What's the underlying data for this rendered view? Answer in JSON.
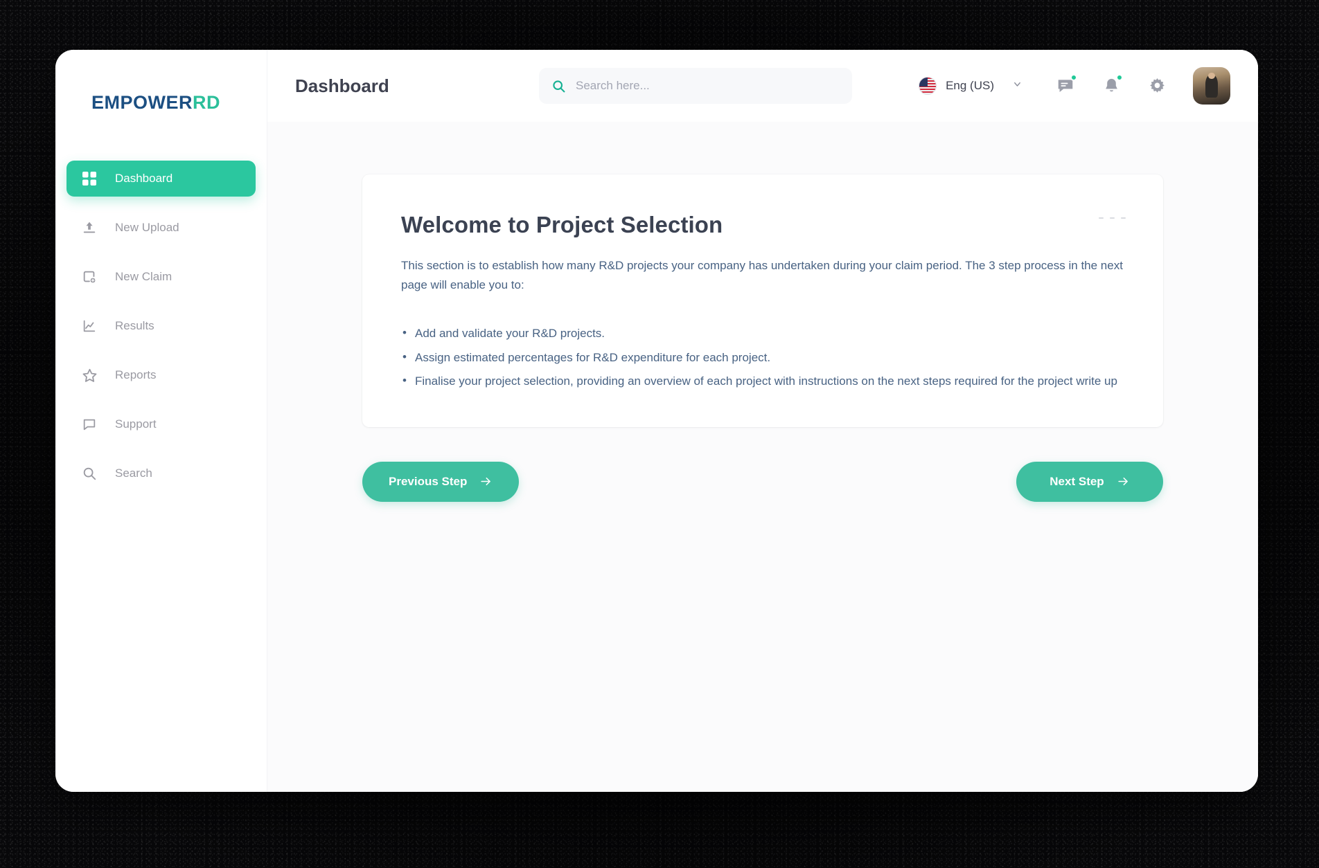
{
  "brand": {
    "logo_primary": "EMPOWER",
    "logo_accent": "RD",
    "accent_color": "#2bc79f",
    "logo_primary_color": "#1c4f82"
  },
  "header": {
    "title": "Dashboard",
    "search": {
      "placeholder": "Search here...",
      "value": "",
      "icon": "search-icon"
    },
    "language": {
      "label": "Eng (US)",
      "flag": "us-flag-icon",
      "chevron": "chevron-down-icon"
    },
    "icons": [
      {
        "name": "messages-icon",
        "has_badge": true,
        "badge_color": "#20c997"
      },
      {
        "name": "notifications-bell-icon",
        "has_badge": true,
        "badge_color": "#20c997"
      },
      {
        "name": "settings-gear-icon",
        "has_badge": false
      }
    ],
    "avatar": "user-avatar"
  },
  "sidebar": {
    "items": [
      {
        "label": "Dashboard",
        "icon": "grid-icon",
        "active": true
      },
      {
        "label": "New Upload",
        "icon": "upload-icon",
        "active": false
      },
      {
        "label": "New Claim",
        "icon": "add-document-icon",
        "active": false
      },
      {
        "label": "Results",
        "icon": "line-chart-icon",
        "active": false
      },
      {
        "label": "Reports",
        "icon": "star-icon",
        "active": false
      },
      {
        "label": "Support",
        "icon": "chat-bubble-icon",
        "active": false
      },
      {
        "label": "Search",
        "icon": "search-icon",
        "active": false
      }
    ]
  },
  "main": {
    "card": {
      "title": "Welcome to Project Selection",
      "paragraph": "This section is to establish how many R&D projects your company has undertaken during your claim period. The 3 step process in the next page will enable you to:",
      "bullets": [
        "Add and validate your R&D projects.",
        "Assign estimated percentages for R&D expenditure for each project.",
        "Finalise your project selection, providing an overview of each project with instructions on the next steps required for the project write up"
      ],
      "menu_icon": "ellipsis-icon"
    },
    "buttons": {
      "previous": {
        "label": "Previous Step",
        "icon": "arrow-right-icon"
      },
      "next": {
        "label": "Next Step",
        "icon": "arrow-right-icon"
      }
    }
  }
}
